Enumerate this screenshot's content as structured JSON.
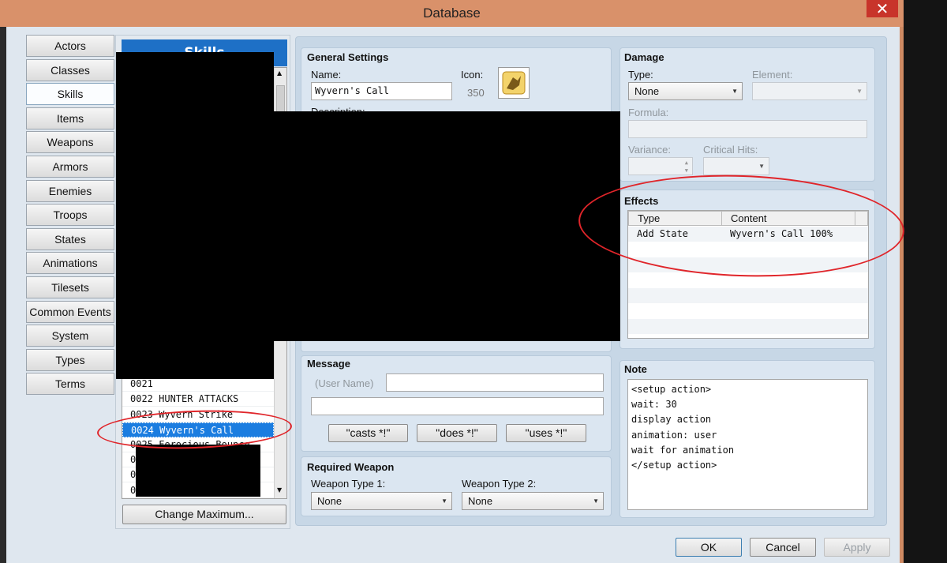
{
  "window": {
    "title": "Database",
    "close_symbol": "✕"
  },
  "tabs": [
    "Actors",
    "Classes",
    "Skills",
    "Items",
    "Weapons",
    "Armors",
    "Enemies",
    "Troops",
    "States",
    "Animations",
    "Tilesets",
    "Common Events",
    "System",
    "Types",
    "Terms"
  ],
  "selected_tab": "Skills",
  "list": {
    "header": "Skills",
    "rows": [
      "0021",
      "0022 HUNTER ATTACKS",
      "0023 Wyvern Strike",
      "0024 Wyvern's Call",
      "0025 Ferocious Bounce"
    ],
    "selected": "0024 Wyvern's Call",
    "partial_rows": [
      "0",
      "0",
      "0"
    ],
    "change_max_label": "Change Maximum..."
  },
  "general": {
    "title": "General Settings",
    "name_label": "Name:",
    "name_value": "Wyvern's Call",
    "icon_label": "Icon:",
    "icon_index": "350",
    "desc_label": "Description:"
  },
  "damage": {
    "title": "Damage",
    "type_label": "Type:",
    "type_value": "None",
    "element_label": "Element:",
    "formula_label": "Formula:",
    "variance_label": "Variance:",
    "critical_label": "Critical Hits:"
  },
  "effects": {
    "title": "Effects",
    "col_type": "Type",
    "col_content": "Content",
    "rows": [
      {
        "type": "Add State",
        "content": "Wyvern's Call 100%"
      }
    ]
  },
  "message": {
    "title": "Message",
    "user_name_label": "(User Name)",
    "btn_casts": "\"casts *!\"",
    "btn_does": "\"does *!\"",
    "btn_uses": "\"uses *!\""
  },
  "note": {
    "title": "Note",
    "lines": [
      "<setup action>",
      "wait: 30",
      "display action",
      "animation: user",
      "wait for animation",
      "</setup action>"
    ]
  },
  "weapon": {
    "title": "Required Weapon",
    "type1_label": "Weapon Type 1:",
    "type1_value": "None",
    "type2_label": "Weapon Type 2:",
    "type2_value": "None"
  },
  "footer": {
    "ok": "OK",
    "cancel": "Cancel",
    "apply": "Apply"
  },
  "colors": {
    "selection": "#1b7de0",
    "titlebar": "#d9916a",
    "annotation": "#e0252a"
  }
}
